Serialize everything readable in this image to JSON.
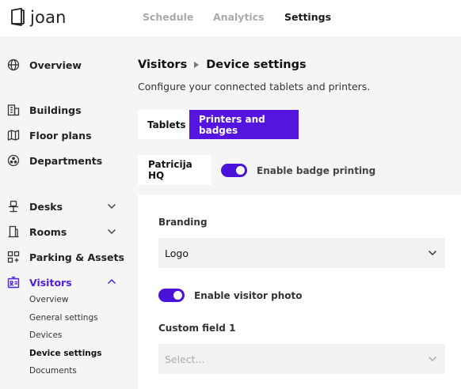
{
  "app": {
    "logo_text": "joan",
    "colors": {
      "accent": "#5514e0",
      "toggle_on": "#4b13d9",
      "muted": "#a9a9a9",
      "background": "#f5f5f5"
    }
  },
  "topnav": {
    "items": [
      {
        "label": "Schedule",
        "active": false
      },
      {
        "label": "Analytics",
        "active": false
      },
      {
        "label": "Settings",
        "active": true
      }
    ]
  },
  "sidebar": {
    "items": [
      {
        "label": "Overview",
        "icon": "globe-icon"
      },
      {
        "label": "Buildings",
        "icon": "building-icon"
      },
      {
        "label": "Floor plans",
        "icon": "map-icon"
      },
      {
        "label": "Departments",
        "icon": "departments-icon"
      },
      {
        "label": "Desks",
        "icon": "desk-chair-icon",
        "expandable": true
      },
      {
        "label": "Rooms",
        "icon": "door-icon",
        "expandable": true
      },
      {
        "label": "Parking & Assets",
        "icon": "grid-plus-icon"
      },
      {
        "label": "Visitors",
        "icon": "visitor-badge-icon",
        "expandable": true,
        "expanded": true,
        "active": true
      }
    ],
    "visitors_sub": [
      {
        "label": "Overview"
      },
      {
        "label": "General settings"
      },
      {
        "label": "Devices"
      },
      {
        "label": "Device settings",
        "active": true
      },
      {
        "label": "Documents"
      }
    ]
  },
  "page": {
    "breadcrumb": [
      "Visitors",
      "Device settings"
    ],
    "subtitle": "Configure your connected tablets and printers.",
    "tabs": [
      {
        "label": "Tablets",
        "selected": false
      },
      {
        "label": "Printers and badges",
        "selected": true
      }
    ],
    "location": "Patricija HQ",
    "badge_printing": {
      "label": "Enable badge printing",
      "enabled": true
    }
  },
  "panel": {
    "branding": {
      "label": "Branding",
      "value": "Logo"
    },
    "visitor_photo": {
      "label": "Enable visitor photo",
      "enabled": true
    },
    "custom_field_1": {
      "label": "Custom field 1",
      "placeholder": "Select..."
    }
  }
}
